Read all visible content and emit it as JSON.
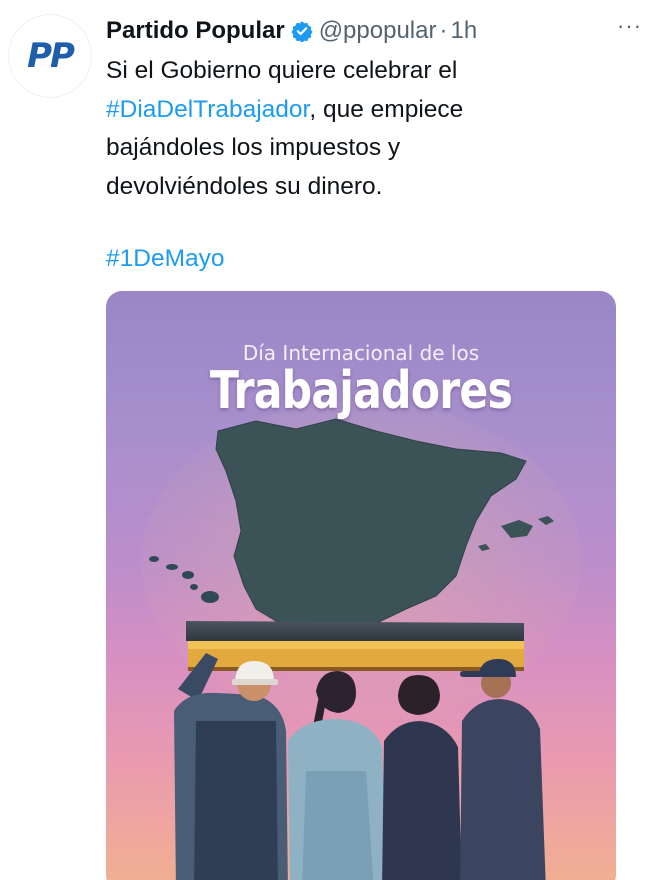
{
  "author": {
    "avatar_text": "PP",
    "display_name": "Partido Popular",
    "handle": "@ppopular",
    "separator": "·",
    "time": "1h",
    "more_label": "···"
  },
  "tweet": {
    "line1": "Si el Gobierno quiere celebrar el",
    "line2_hashtag": "#DiaDelTrabajador",
    "line2_rest": ", que empiece",
    "line3": "bajándoles los impuestos y",
    "line4": "devolviéndoles su dinero.",
    "hashtag2": "#1DeMayo"
  },
  "poster": {
    "subtitle": "Día Internacional de los",
    "title": "Trabajadores"
  },
  "colors": {
    "hashtag": "#1d9bf0",
    "verified": "#1d9bf0",
    "brand": "#1d5fa8"
  }
}
